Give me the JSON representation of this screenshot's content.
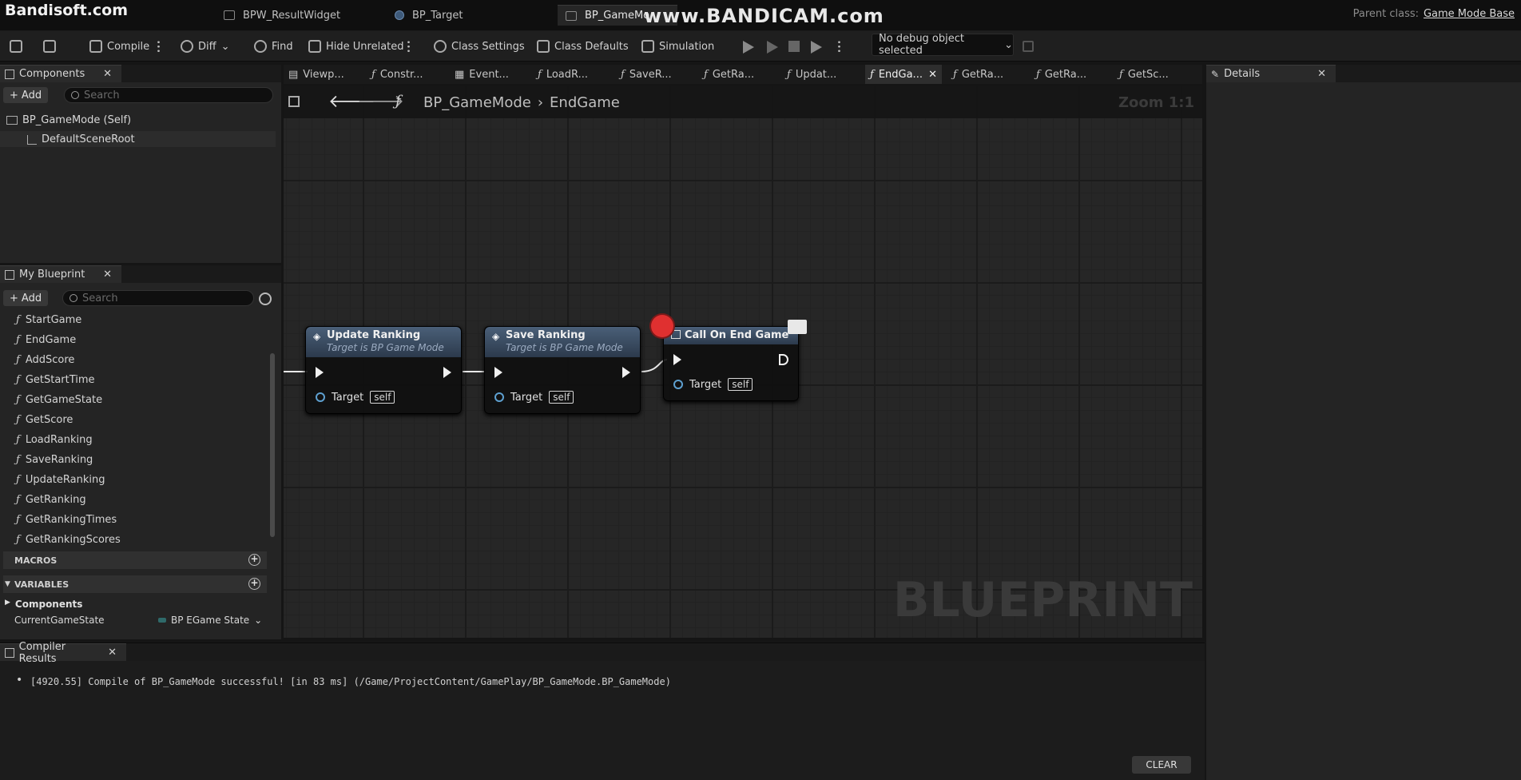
{
  "overlay": {
    "bandisoft": "Bandisoft.com",
    "watermark": "www.BANDICAM.com"
  },
  "doc_tabs": [
    {
      "label": "BPW_ResultWidget"
    },
    {
      "label": "BP_Target"
    },
    {
      "label": "BP_GameMo"
    }
  ],
  "parent_class": {
    "label": "Parent class:",
    "value": "Game Mode Base"
  },
  "toolbar": {
    "compile": "Compile",
    "diff": "Diff",
    "find": "Find",
    "hide_unrelated": "Hide Unrelated",
    "class_settings": "Class Settings",
    "class_defaults": "Class Defaults",
    "simulation": "Simulation",
    "debug_object": "No debug object selected"
  },
  "components_panel": {
    "title": "Components",
    "add": "Add",
    "search_placeholder": "Search",
    "items": [
      "BP_GameMode (Self)",
      "DefaultSceneRoot"
    ]
  },
  "my_blueprint": {
    "title": "My Blueprint",
    "add": "Add",
    "search_placeholder": "Search",
    "functions": [
      "StartGame",
      "EndGame",
      "AddScore",
      "GetStartTime",
      "GetGameState",
      "GetScore",
      "LoadRanking",
      "SaveRanking",
      "UpdateRanking",
      "GetRanking",
      "GetRankingTimes",
      "GetRankingScores"
    ],
    "macros_label": "MACROS",
    "variables_label": "VARIABLES",
    "components_label": "Components",
    "variable": {
      "name": "CurrentGameState",
      "type": "BP EGame State"
    }
  },
  "graph_tabs": [
    "Viewp...",
    "Constr...",
    "Event...",
    "LoadR...",
    "SaveR...",
    "GetRa...",
    "Updat...",
    "EndGa...",
    "GetRa...",
    "GetRa...",
    "GetSc..."
  ],
  "graph": {
    "breadcrumb_root": "BP_GameMode",
    "breadcrumb_current": "EndGame",
    "zoom": "Zoom 1:1",
    "watermark": "BLUEPRINT",
    "nodes": [
      {
        "title": "Update Ranking",
        "subtitle": "Target is BP Game Mode",
        "target": "Target",
        "self": "self"
      },
      {
        "title": "Save Ranking",
        "subtitle": "Target is BP Game Mode",
        "target": "Target",
        "self": "self"
      },
      {
        "title": "Call On End Game",
        "target": "Target",
        "self": "self"
      }
    ]
  },
  "details_panel": {
    "title": "Details"
  },
  "compiler": {
    "title": "Compiler Results",
    "message": "[4920.55] Compile of BP_GameMode successful! [in 83 ms] (/Game/ProjectContent/GamePlay/BP_GameMode.BP_GameMode)",
    "clear": "CLEAR"
  }
}
